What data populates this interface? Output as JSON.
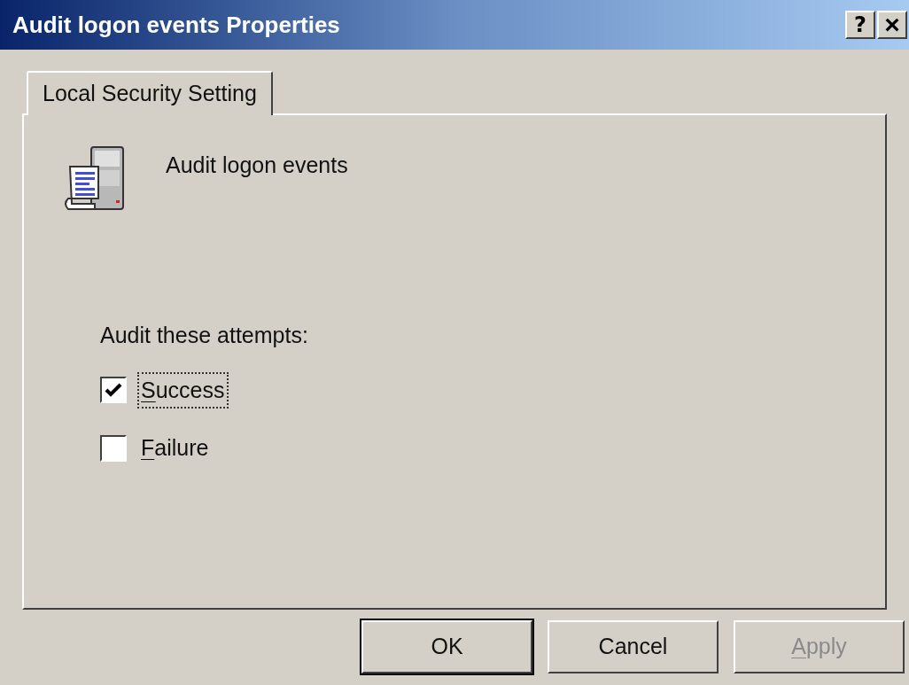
{
  "window": {
    "title": "Audit logon events Properties",
    "title_buttons": [
      {
        "kind": "help",
        "label": "?"
      },
      {
        "kind": "close",
        "label": "×"
      }
    ]
  },
  "tabs": [
    {
      "label": "Local Security Setting",
      "selected": true
    }
  ],
  "policy": {
    "name": "Audit logon events"
  },
  "attempts": {
    "label": "Audit these attempts:",
    "options": [
      {
        "label": "Success",
        "first_letter_underlined": true,
        "checked": true,
        "focused": true
      },
      {
        "label": "Failure",
        "first_letter_underlined": true,
        "checked": false,
        "focused": false
      }
    ]
  },
  "buttons": [
    {
      "label": "OK",
      "first_letter_underlined": false,
      "default": true,
      "disabled": false
    },
    {
      "label": "Cancel",
      "first_letter_underlined": false,
      "default": false,
      "disabled": false
    },
    {
      "label": "Apply",
      "first_letter_underlined": true,
      "default": false,
      "disabled": true
    }
  ]
}
